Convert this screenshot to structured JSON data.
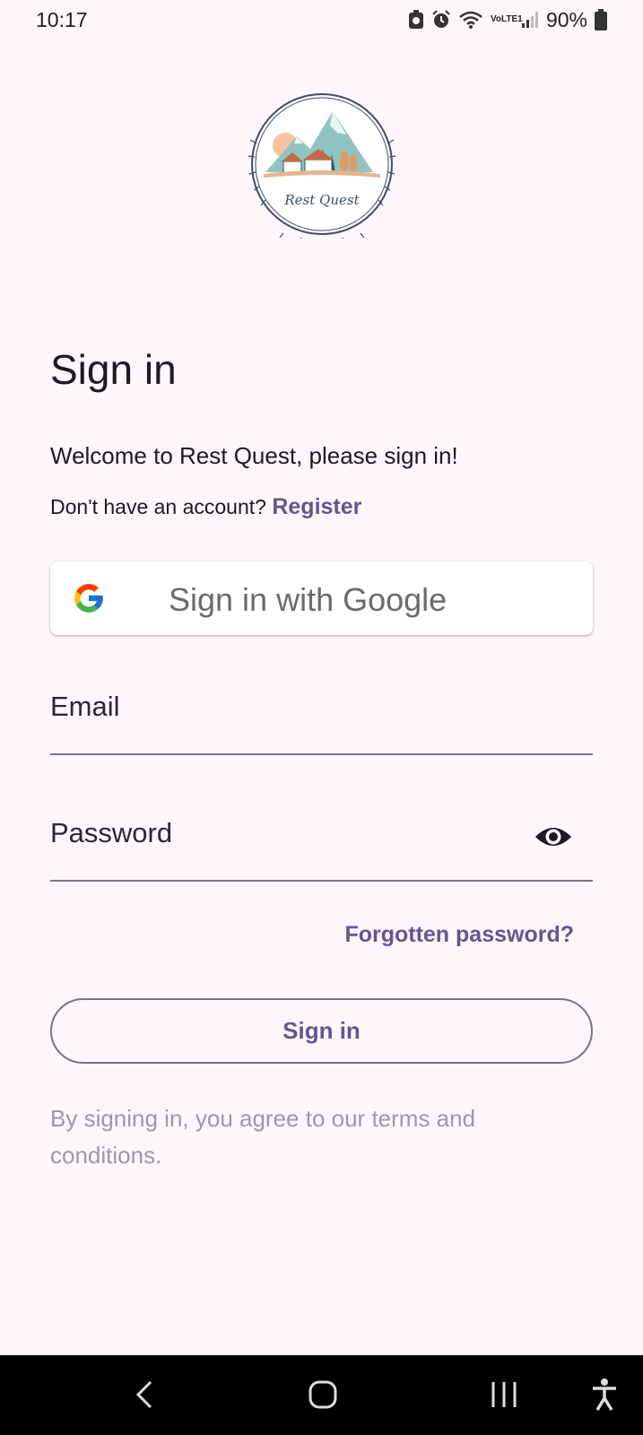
{
  "status_bar": {
    "time": "10:17",
    "battery_text": "90%",
    "network_text": "VoLTE1"
  },
  "logo": {
    "name": "rest-quest-logo",
    "script_text": "Rest Quest"
  },
  "title": "Sign in",
  "welcome_text": "Welcome to Rest Quest, please sign in!",
  "register": {
    "prompt": "Don't have an account? ",
    "link_label": "Register"
  },
  "google_button": {
    "label": "Sign in with Google",
    "icon": "google-icon"
  },
  "email_field": {
    "label": "Email",
    "value": ""
  },
  "password_field": {
    "label": "Password",
    "value": "",
    "icon": "eye-icon"
  },
  "forgot_password_label": "Forgotten password?",
  "signin_button_label": "Sign in",
  "terms_text": "By signing in, you agree to our terms and conditions.",
  "nav_bar": {
    "back": "back-icon",
    "home": "home-icon",
    "recents": "recents-icon",
    "accessibility": "accessibility-icon"
  },
  "colors": {
    "background": "#fdf7fc",
    "accent": "#65558f",
    "muted_text": "#9b9b9f",
    "outline": "#79747e"
  }
}
